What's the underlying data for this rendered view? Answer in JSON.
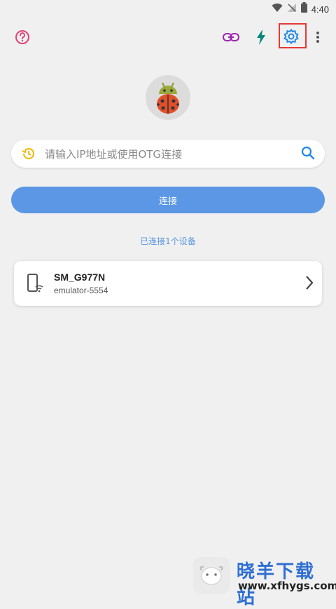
{
  "status_bar": {
    "time": "4:40",
    "icons": [
      "wifi-icon",
      "signal-off-icon",
      "battery-icon"
    ]
  },
  "toolbar": {
    "icons": [
      "help-icon",
      "link-icon",
      "flash-icon",
      "settings-icon",
      "more-vert-icon"
    ]
  },
  "search": {
    "placeholder": "请输入IP地址或使用OTG连接"
  },
  "connect_button": {
    "label": "连接"
  },
  "connected_count": "已连接1个设备",
  "devices": [
    {
      "name": "SM_G977N",
      "serial": "emulator-5554"
    }
  ],
  "watermark": {
    "title": "晓羊下载站",
    "url": "www.xfhygs.com"
  },
  "colors": {
    "accent": "#5b97e4",
    "help": "#e0437a",
    "link": "#9c27b0",
    "flash": "#00897b",
    "settings": "#1e88e5",
    "history": "#f2b705"
  }
}
